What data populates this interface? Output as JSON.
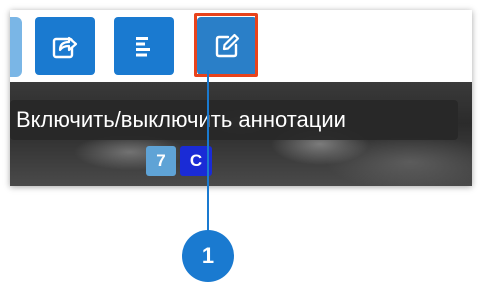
{
  "toolbar": {
    "buttons": [
      {
        "name": "share",
        "icon": "share-icon"
      },
      {
        "name": "align",
        "icon": "align-left-icon"
      },
      {
        "name": "annotate",
        "icon": "edit-icon",
        "highlighted": true
      }
    ]
  },
  "tooltip": {
    "text": "Включить/выключить аннотации"
  },
  "image_overlay": {
    "badges": [
      "7",
      "C"
    ]
  },
  "callout": {
    "number": "1"
  },
  "colors": {
    "button_blue": "#1a7ad0",
    "highlight_border": "#e8431c",
    "badge_7": "#5fa3d6",
    "badge_c": "#1a2bd6",
    "tooltip_bg": "#282828"
  }
}
